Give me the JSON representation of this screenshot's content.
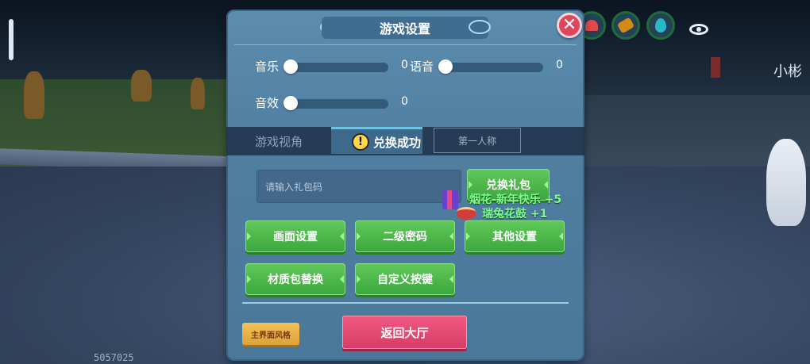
{
  "panel": {
    "title": "游戏设置",
    "close_symbol": "✕"
  },
  "sliders": {
    "music": {
      "label": "音乐",
      "value": "0",
      "level": 0
    },
    "voice": {
      "label": "语音",
      "value": "0",
      "level": 0
    },
    "sfx": {
      "label": "音效",
      "value": "0",
      "level": 0
    }
  },
  "view": {
    "label": "游戏视角",
    "option_second": "第一人称"
  },
  "toast": {
    "icon": "!",
    "text": "兑换成功"
  },
  "gift": {
    "placeholder": "请输入礼包码",
    "redeem_label": "兑换礼包"
  },
  "rewards": [
    {
      "text": "烟花-新年快乐 +5",
      "icon": "firework-icon"
    },
    {
      "text": "瑞兔花鼓 +1",
      "icon": "drum-icon"
    }
  ],
  "buttons": {
    "graphics": "画面设置",
    "second_password": "二级密码",
    "other": "其他设置",
    "texture_pack": "材质包替换",
    "custom_keys": "自定义按键",
    "main_style": "主界面风格",
    "return_lobby": "返回大厅"
  },
  "hud": {
    "name_tag": "小彬",
    "build_code": "5057025",
    "icons": [
      "heart-icon",
      "food-icon",
      "water-drop-icon",
      "eye-icon"
    ]
  },
  "colors": {
    "panel": "#5d8dae",
    "green_button": "#4cb84a",
    "return_button": "#e14c74",
    "style_button": "#e8b247",
    "close_button": "#e0455c",
    "reward_text": "#7dfd8c"
  }
}
